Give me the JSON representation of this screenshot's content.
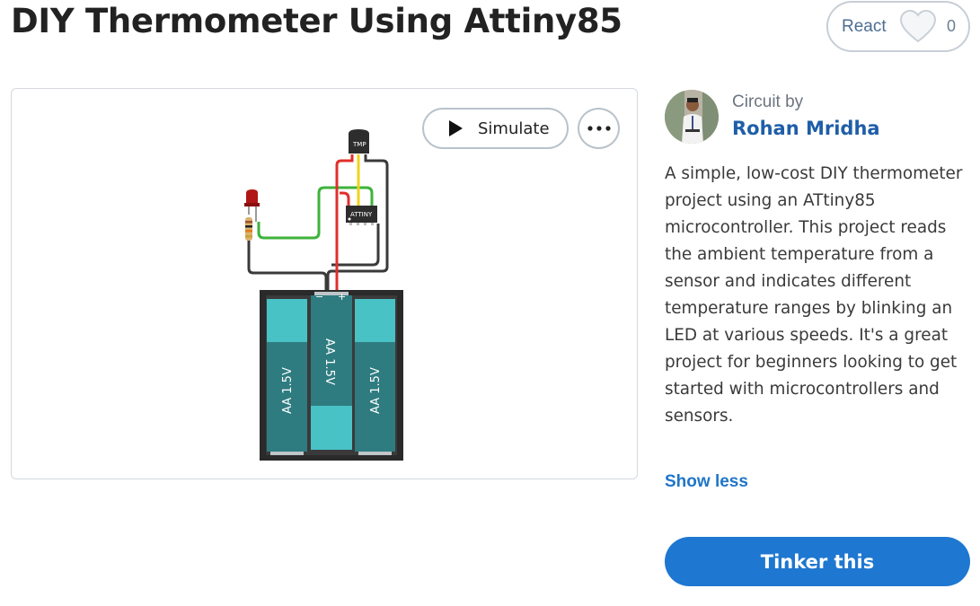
{
  "header": {
    "title": "DIY Thermometer Using Attiny85",
    "react_label": "React",
    "react_count": "0",
    "react_icon": "heart-icon"
  },
  "canvas": {
    "simulate_label": "Simulate",
    "simulate_icon": "play-icon",
    "more_icon": "more-options-icon",
    "components": {
      "sensor_label": "TMP",
      "chip_label": "ATTINY",
      "battery_labels": [
        "AA 1.5V",
        "AA 1.5V",
        "AA 1.5V"
      ],
      "minus_terminal": "−",
      "plus_terminal": "+"
    },
    "wire_colors": {
      "red": "#e0302b",
      "yellow": "#f1d21a",
      "green": "#3db33a",
      "black": "#3a3a3a"
    }
  },
  "author": {
    "circuit_by": "Circuit by",
    "name": "Rohan Mridha"
  },
  "description": "A simple, low-cost DIY thermometer project using an ATtiny85 microcontroller. This project reads the ambient temperature from a sensor and indicates different temperature ranges by blinking an LED at various speeds. It's a great project for beginners looking to get started with microcontrollers and sensors.",
  "show_less_label": "Show less",
  "tinker_label": "Tinker this",
  "colors": {
    "accent": "#1e77d0",
    "author_link": "#1f5ea8",
    "battery_teal": "#2f7c80",
    "battery_cyan": "#49c2c6"
  }
}
